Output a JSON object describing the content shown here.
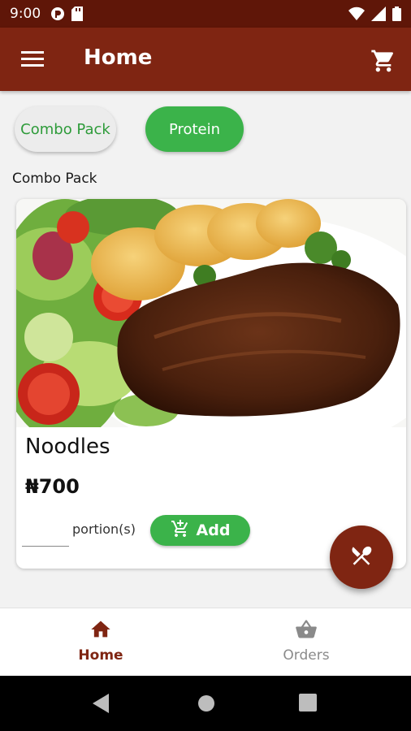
{
  "status_bar": {
    "time": "9:00",
    "left_icons": [
      "pocket-casts-icon",
      "sd-card-icon"
    ],
    "right_icons": [
      "wifi-icon",
      "signal-icon",
      "battery-icon"
    ]
  },
  "app_bar": {
    "title": "Home",
    "menu_icon": "hamburger-menu-icon",
    "cart_icon": "shopping-cart-icon",
    "background_color": "#7f2512"
  },
  "categories": [
    {
      "label": "Combo Pack",
      "selected": false
    },
    {
      "label": "Protein",
      "selected": true
    }
  ],
  "section": {
    "title": "Combo Pack"
  },
  "product": {
    "image": "steak-with-salad-and-potatoes-photo",
    "name": "Noodles",
    "price": "₦700",
    "portion_value": "",
    "portion_label": "portion(s)",
    "add_label": "Add",
    "add_icon": "add-to-cart-icon"
  },
  "fab": {
    "icon": "fork-knife-icon"
  },
  "bottom_nav": {
    "items": [
      {
        "label": "Home",
        "icon": "home-icon",
        "active": true
      },
      {
        "label": "Orders",
        "icon": "basket-icon",
        "active": false
      }
    ]
  },
  "accent_colors": {
    "green": "#3bb34a",
    "brown": "#7f2512"
  }
}
